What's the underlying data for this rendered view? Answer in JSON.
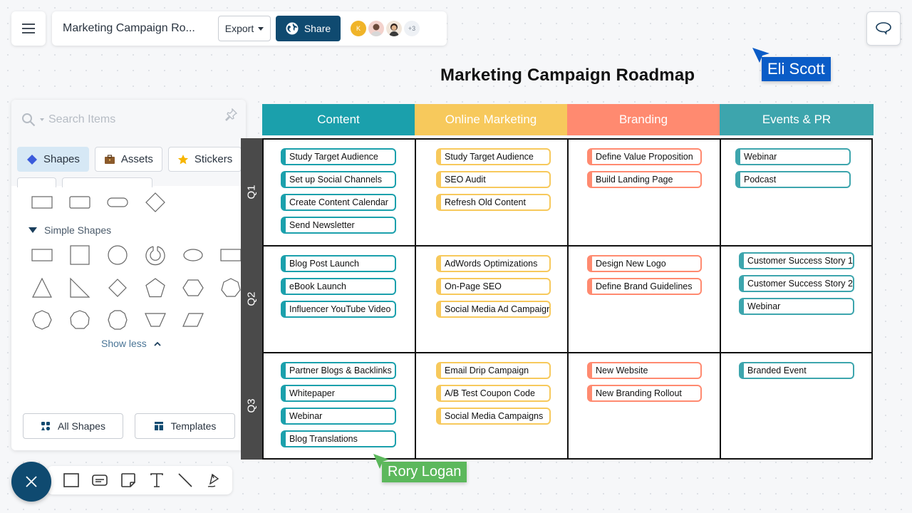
{
  "header": {
    "doc_title": "Marketing Campaign Ro...",
    "export_label": "Export",
    "share_label": "Share",
    "avatars": [
      {
        "initial": "K",
        "color": "#f0b429"
      },
      {
        "initial": "",
        "color": "#c9a08a"
      },
      {
        "initial": "",
        "color": "#e8c9a8"
      }
    ],
    "extra_collaborators": "+3"
  },
  "board": {
    "title": "Marketing Campaign Roadmap",
    "columns": [
      {
        "label": "Content",
        "color": "#1ba0ac"
      },
      {
        "label": "Online Marketing",
        "color": "#f7c95c"
      },
      {
        "label": "Branding",
        "color": "#ff8a70"
      },
      {
        "label": "Events & PR",
        "color": "#3da5ad"
      }
    ],
    "rows": [
      "Q1",
      "Q2",
      "Q3"
    ],
    "cells": [
      [
        [
          "Study Target Audience",
          "Set up Social Channels",
          "Create Content Calendar",
          "Send  Newsletter"
        ],
        [
          "Study Target Audience",
          "SEO Audit",
          "Refresh Old Content"
        ],
        [
          "Define Value Proposition",
          "Build Landing Page"
        ],
        [
          "Webinar",
          "Podcast"
        ]
      ],
      [
        [
          "Blog Post Launch",
          "eBook Launch",
          "Influencer YouTube Video"
        ],
        [
          "AdWords Optimizations",
          "On-Page SEO",
          "Social Media Ad Campaign"
        ],
        [
          "Design New Logo",
          "Define Brand Guidelines"
        ],
        [
          "Customer Success Story 1",
          "Customer Success Story 2",
          "Webinar"
        ]
      ],
      [
        [
          "Partner Blogs & Backlinks",
          "Whitepaper",
          "Webinar",
          "Blog Translations"
        ],
        [
          "Email Drip Campaign",
          "A/B Test Coupon Code",
          "Social Media Campaigns"
        ],
        [
          "New Website",
          "New Branding Rollout"
        ],
        [
          "Branded Event"
        ]
      ]
    ]
  },
  "cursors": [
    {
      "name": "Eli Scott",
      "color": "#0a5cc7"
    },
    {
      "name": "Rory Logan",
      "color": "#5cb85c"
    }
  ],
  "panel": {
    "search_placeholder": "Search Items",
    "tabs": [
      {
        "label": "Shapes",
        "icon": "diamond-icon"
      },
      {
        "label": "Assets",
        "icon": "briefcase-icon"
      },
      {
        "label": "Stickers",
        "icon": "star-icon"
      }
    ],
    "section_title": "Simple Shapes",
    "show_less": "Show less",
    "all_shapes": "All Shapes",
    "templates": "Templates"
  }
}
